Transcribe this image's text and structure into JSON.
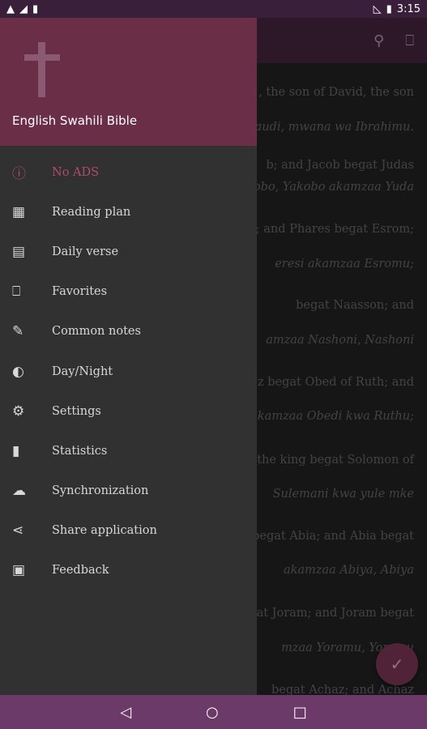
{
  "status_bar": {
    "left_icons": [
      "warning-icon",
      "no-sim-icon",
      "sd-card-icon"
    ],
    "time": "3:15"
  },
  "toolbar": {
    "actions": [
      "search-icon",
      "bookmark-icon"
    ]
  },
  "content": {
    "verses": [
      {
        "text": ", the son of David, the son",
        "lang": "en"
      },
      {
        "text": "Daudi, mwana wa Ibrahimu.",
        "lang": "sw"
      },
      {
        "text": "b; and Jacob begat Judas",
        "lang": "en"
      },
      {
        "text": "obo, Yakobo akamzaa Yuda",
        "lang": "sw"
      },
      {
        "text": "ar; and Phares begat Esrom;",
        "lang": "en"
      },
      {
        "text": "eresi akamzaa Esromu;",
        "lang": "sw"
      },
      {
        "text": "begat Naasson; and",
        "lang": "en"
      },
      {
        "text": "amzaa Nashoni, Nashoni",
        "lang": "sw"
      },
      {
        "text": "z begat Obed of Ruth; and",
        "lang": "en"
      },
      {
        "text": "akamzaa Obedi kwa Ruthu;",
        "lang": "sw"
      },
      {
        "text": "the king begat Solomon of",
        "lang": "en"
      },
      {
        "text": "Sulemani kwa yule mke",
        "lang": "sw"
      },
      {
        "text": "begat Abia; and Abia begat",
        "lang": "en"
      },
      {
        "text": "akamzaa Abiya, Abiya",
        "lang": "sw"
      },
      {
        "text": "gat Joram; and Joram begat",
        "lang": "en"
      },
      {
        "text": "mzaa Yoramu, Yoramu",
        "lang": "sw"
      },
      {
        "text": "begat Achaz; and Achaz",
        "lang": "en"
      }
    ]
  },
  "fab": {
    "icon": "check-icon"
  },
  "drawer": {
    "title": "English Swahili Bible",
    "items": [
      {
        "label": "No ADS",
        "icon": "info-icon",
        "accent": true
      },
      {
        "label": "Reading plan",
        "icon": "calendar-icon"
      },
      {
        "label": "Daily verse",
        "icon": "news-icon"
      },
      {
        "label": "Favorites",
        "icon": "bookmark-icon"
      },
      {
        "label": "Common notes",
        "icon": "edit-icon"
      },
      {
        "label": "Day/Night",
        "icon": "brightness-icon"
      },
      {
        "label": "Settings",
        "icon": "gear-icon"
      },
      {
        "label": "Statistics",
        "icon": "bar-chart-icon"
      },
      {
        "label": "Synchronization",
        "icon": "cloud-upload-icon"
      },
      {
        "label": "Share application",
        "icon": "share-icon"
      },
      {
        "label": "Feedback",
        "icon": "feedback-icon"
      }
    ]
  },
  "colors": {
    "accent": "#b14a6f",
    "header": "#6a2e47",
    "nav_bar": "#6b3a68"
  }
}
